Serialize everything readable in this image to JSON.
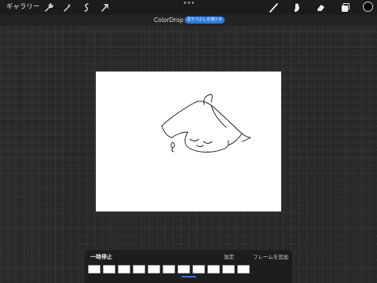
{
  "window": {
    "gallery_label": "ギャラリー"
  },
  "toolbar": {
    "left_tools": [
      "wrench-icon",
      "magic-wand-icon",
      "selection-icon",
      "transform-arrow-icon"
    ],
    "right_tools": [
      "brush-icon",
      "smudge-icon",
      "eraser-icon",
      "layers-icon"
    ],
    "current_color": "#050505"
  },
  "colordrop": {
    "title": "ColorDrop",
    "fill_button_label": "塗りつぶしを続ける",
    "accent_color": "#2d7be0"
  },
  "timeline": {
    "pause_label": "一時停止",
    "settings_label": "設定",
    "add_frame_label": "フレームを追加",
    "frame_count": 11,
    "current_frame": 6
  }
}
